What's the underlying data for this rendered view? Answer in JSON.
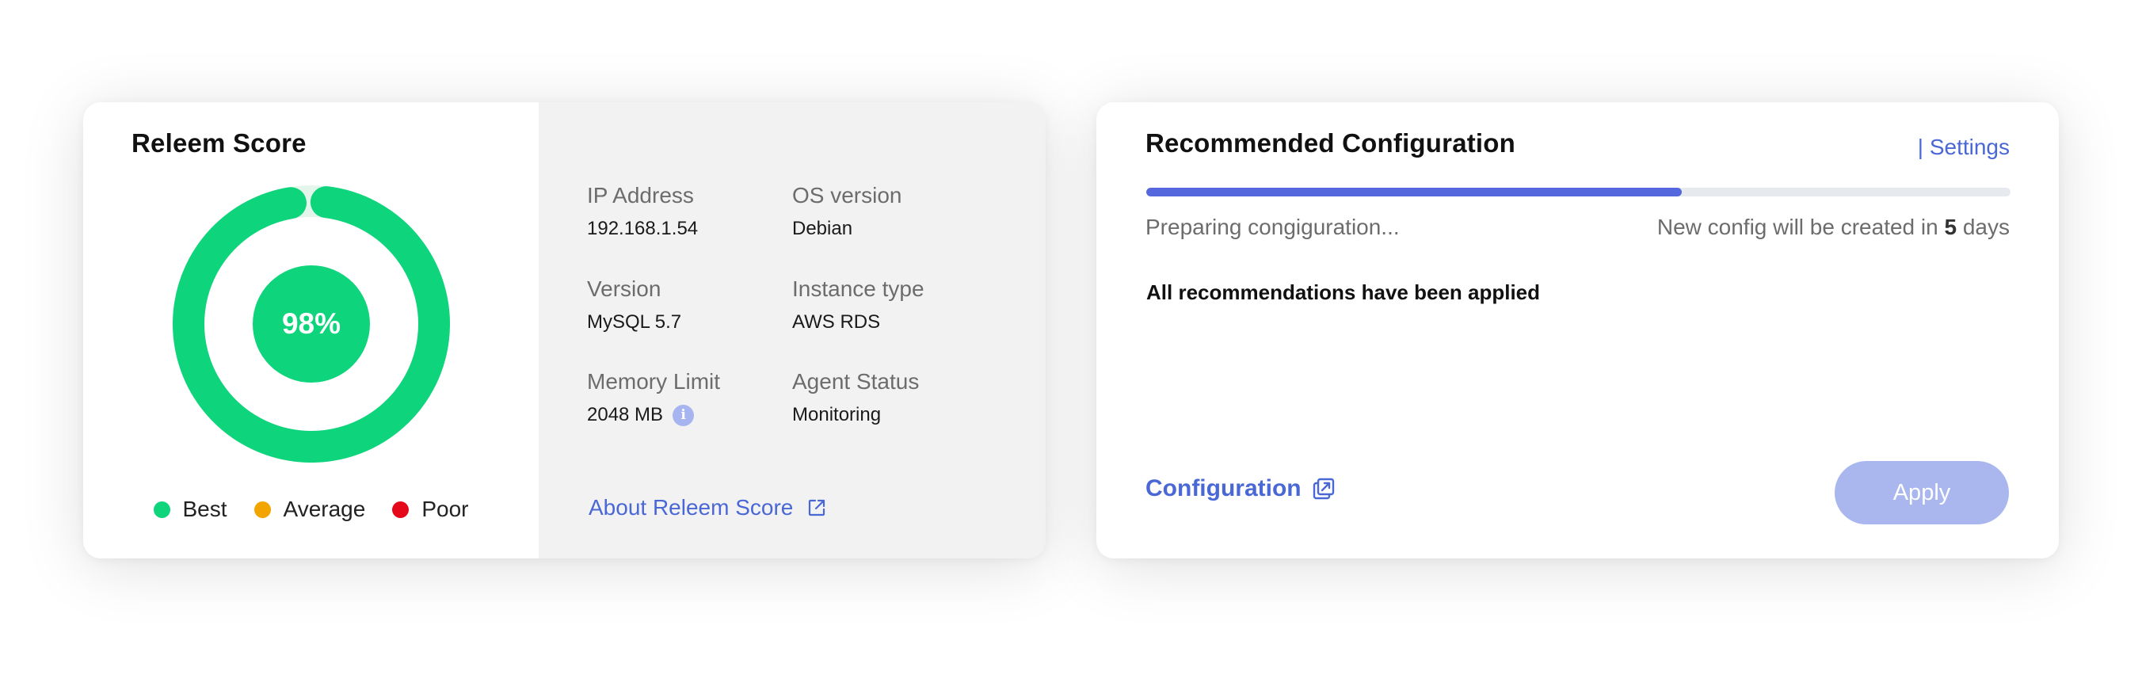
{
  "score_card": {
    "title": "Releem Score",
    "score_label": "98%",
    "score_value": 0.98,
    "colors": {
      "ring": "#0ed47c",
      "track": "#e4f6ec"
    },
    "legend": [
      {
        "label": "Best",
        "color": "#0ed47c"
      },
      {
        "label": "Average",
        "color": "#f2a500"
      },
      {
        "label": "Poor",
        "color": "#e5081a"
      }
    ],
    "info": {
      "ip_label": "IP Address",
      "ip_value": "192.168.1.54",
      "os_label": "OS version",
      "os_value": "Debian",
      "version_label": "Version",
      "version_value": "MySQL 5.7",
      "instance_label": "Instance type",
      "instance_value": "AWS RDS",
      "memory_label": "Memory Limit",
      "memory_value": "2048 MB",
      "agent_label": "Agent Status",
      "agent_value": "Monitoring"
    },
    "about_link": "About Releem Score"
  },
  "config_card": {
    "title": "Recommended Configuration",
    "settings_link": "| Settings",
    "progress": 0.62,
    "preparing_text": "Preparing congiguration...",
    "new_config_prefix": "New config will be created in ",
    "new_config_days": "5",
    "new_config_suffix": " days",
    "applied_text": "All recommendations have been applied",
    "configuration_link": "Configuration",
    "apply_button": "Apply"
  }
}
